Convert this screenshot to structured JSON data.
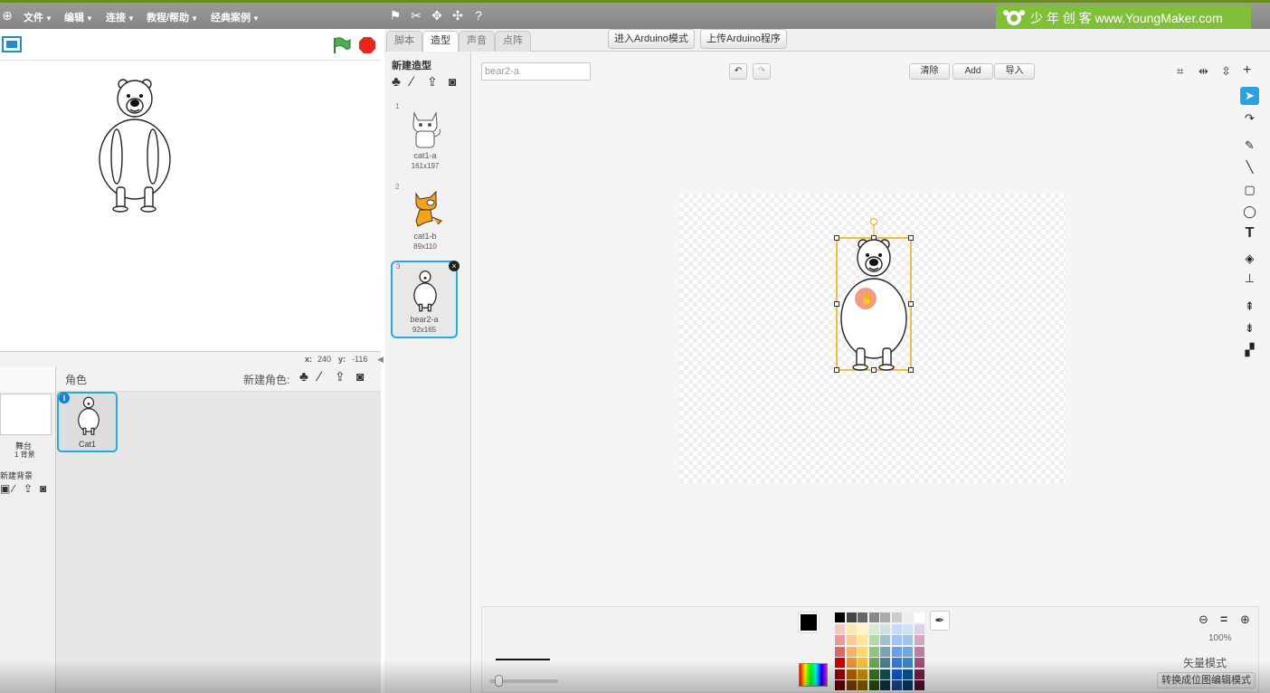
{
  "menubar": {
    "items": [
      "文件",
      "编辑",
      "连接",
      "教程/帮助",
      "经典案例"
    ],
    "brand_text": "少 年 创 客 www.YoungMaker.com"
  },
  "stage": {
    "coords": {
      "x_label": "x:",
      "x_value": "240",
      "y_label": "y:",
      "y_value": "-116"
    }
  },
  "sprites_panel": {
    "title": "角色",
    "new_sprite_label": "新建角色:",
    "stage_label": "舞台",
    "stage_backdrops": "1 背景",
    "new_backdrop_label": "新建背景",
    "sprites": [
      {
        "name": "Cat1"
      }
    ]
  },
  "tabs": [
    {
      "label": "脚本"
    },
    {
      "label": "造型"
    },
    {
      "label": "声音"
    },
    {
      "label": "点阵"
    }
  ],
  "header_buttons": {
    "arduino_mode": "进入Arduino模式",
    "upload": "上传Arduino程序"
  },
  "costumes": {
    "new_label": "新建造型",
    "items": [
      {
        "num": "1",
        "name": "cat1-a",
        "size": "161x197"
      },
      {
        "num": "2",
        "name": "cat1-b",
        "size": "89x110"
      },
      {
        "num": "3",
        "name": "bear2-a",
        "size": "92x165"
      }
    ]
  },
  "editor": {
    "name_value": "bear2-a",
    "clear": "清除",
    "add": "Add",
    "import": "导入",
    "zoom": "100%",
    "mode": "矢量模式",
    "convert": "转换成位图编辑模式"
  },
  "colors": {
    "accent": "#26a8e0",
    "brand": "#7fbf3a",
    "selection": "#f0a800"
  }
}
